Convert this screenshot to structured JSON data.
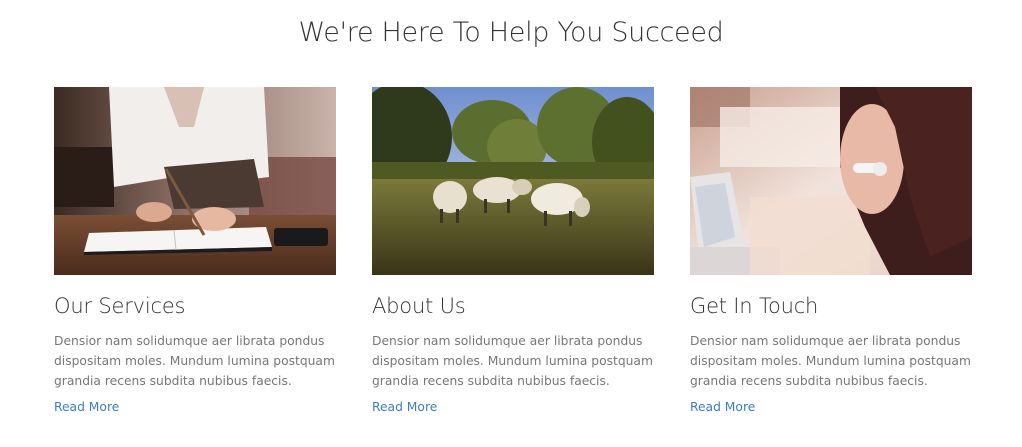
{
  "section": {
    "title": "We're Here To Help You Succeed"
  },
  "cards": [
    {
      "image": "person-writing-in-notebook-photo",
      "title": "Our Services",
      "text": "Densior nam solidumque aer librata pondus dispositam moles. Mundum lumina postquam grandia recens subdita nubibus faecis.",
      "link": "Read More"
    },
    {
      "image": "sheep-grazing-in-field-photo",
      "title": "About Us",
      "text": "Densior nam solidumque aer librata pondus dispositam moles. Mundum lumina postquam grandia recens subdita nubibus faecis.",
      "link": "Read More"
    },
    {
      "image": "woman-with-headset-at-laptop-photo",
      "title": "Get In Touch",
      "text": "Densior nam solidumque aer librata pondus dispositam moles. Mundum lumina postquam grandia recens subdita nubibus faecis.",
      "link": "Read More"
    }
  ],
  "colors": {
    "heading": "#333333",
    "body_text": "#777777",
    "link": "#3a7fc1"
  }
}
